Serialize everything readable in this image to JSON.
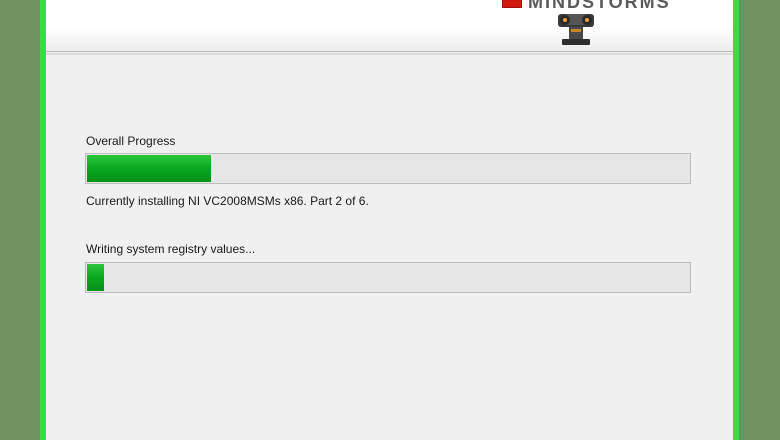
{
  "header": {
    "logo_text": "MINDSTORMS",
    "logo_accent": "#d11b12"
  },
  "progress": {
    "overall_label": "Overall Progress",
    "overall_value": 0.205,
    "status_text": "Currently installing NI VC2008MSMs x86.  Part 2 of 6.",
    "step_label": "Writing system registry values...",
    "step_value": 0.028,
    "bar_color": "#0aa81e"
  }
}
